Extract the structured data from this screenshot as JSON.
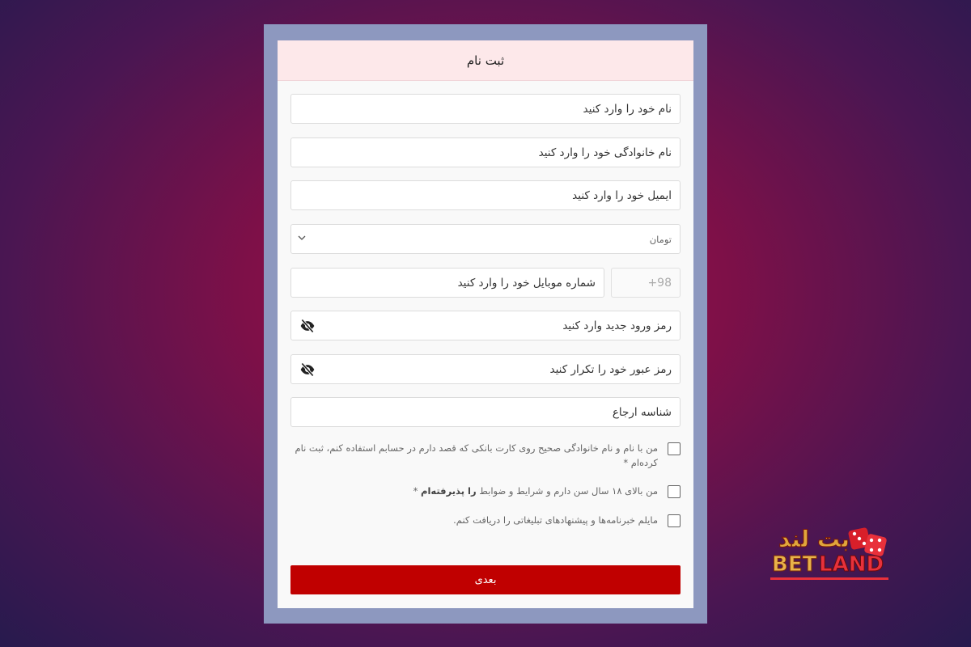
{
  "form": {
    "title": "ثبت نام",
    "first_name_placeholder": "نام خود را وارد کنید",
    "last_name_placeholder": "نام خانوادگی خود را وارد کنید",
    "email_placeholder": "ایمیل خود را وارد کنید",
    "currency_selected": "تومان",
    "phone_prefix": "+98",
    "phone_placeholder": "شماره موبایل خود را وارد کنید",
    "password_placeholder": "رمز ورود جدید وارد کنید",
    "password_repeat_placeholder": "رمز عبور خود را تکرار کنید",
    "referral_placeholder": "شناسه ارجاع",
    "checkbox_bank_card": "من با نام و نام خانوادگی صحیح روی کارت بانکی که قصد دارم در حسابم استفاده کنم، ثبت نام کرده‌ام *",
    "checkbox_age_prefix": "من بالای ۱۸ سال سن دارم و شرایط و ضوابط ",
    "checkbox_age_link": "را پذیرفته‌ام",
    "checkbox_age_suffix": " *",
    "checkbox_newsletter": "مایلم خبرنامه‌ها و پیشنهادهای تبلیغاتی را دریافت کنم.",
    "submit_label": "بعدی"
  },
  "icons": {
    "password_toggle": "eye-slash-icon",
    "select_arrow": "chevron-down-icon"
  },
  "brand": {
    "logo_text_fa": "بت لند",
    "logo_text_en": "BETLAND"
  },
  "colors": {
    "primary_button": "#c00000",
    "header_bg": "#fde8ea",
    "frame": "#8d98bf"
  }
}
